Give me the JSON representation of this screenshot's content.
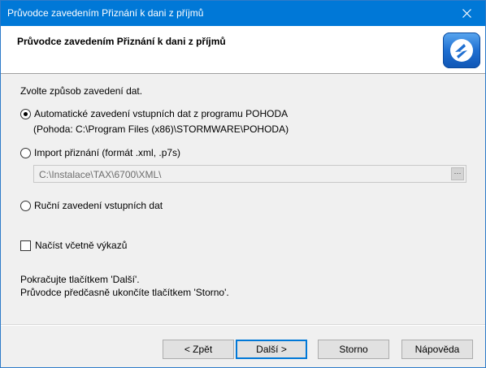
{
  "window": {
    "title": "Průvodce zavedením Přiznání k dani z příjmů",
    "close_glyph": "✕"
  },
  "header": {
    "title": "Průvodce zavedením Přiznání k dani z příjmů",
    "logo_icon": "pohoda-logo-icon"
  },
  "main": {
    "prompt": "Zvolte způsob zavedení dat.",
    "options": [
      {
        "label": "Automatické zavedení vstupních dat z programu POHODA",
        "detail": "(Pohoda: C:\\Program Files (x86)\\STORMWARE\\POHODA)",
        "selected": true
      },
      {
        "label": "Import přiznání (formát .xml, .p7s)",
        "selected": false
      },
      {
        "label": "Ruční zavedení vstupních dat",
        "selected": false
      }
    ],
    "import_path": "C:\\Instalace\\TAX\\6700\\XML\\",
    "browse_label": "···",
    "include_reports_label": "Načíst včetně výkazů",
    "include_reports_checked": false,
    "info_line1": "Pokračujte tlačítkem 'Další'.",
    "info_line2": "Průvodce předčasně ukončíte tlačítkem 'Storno'."
  },
  "buttons": {
    "back": "< Zpět",
    "next": "Další >",
    "cancel": "Storno",
    "help": "Nápověda"
  },
  "colors": {
    "titlebar": "#0078d7",
    "accent": "#0078d7"
  }
}
